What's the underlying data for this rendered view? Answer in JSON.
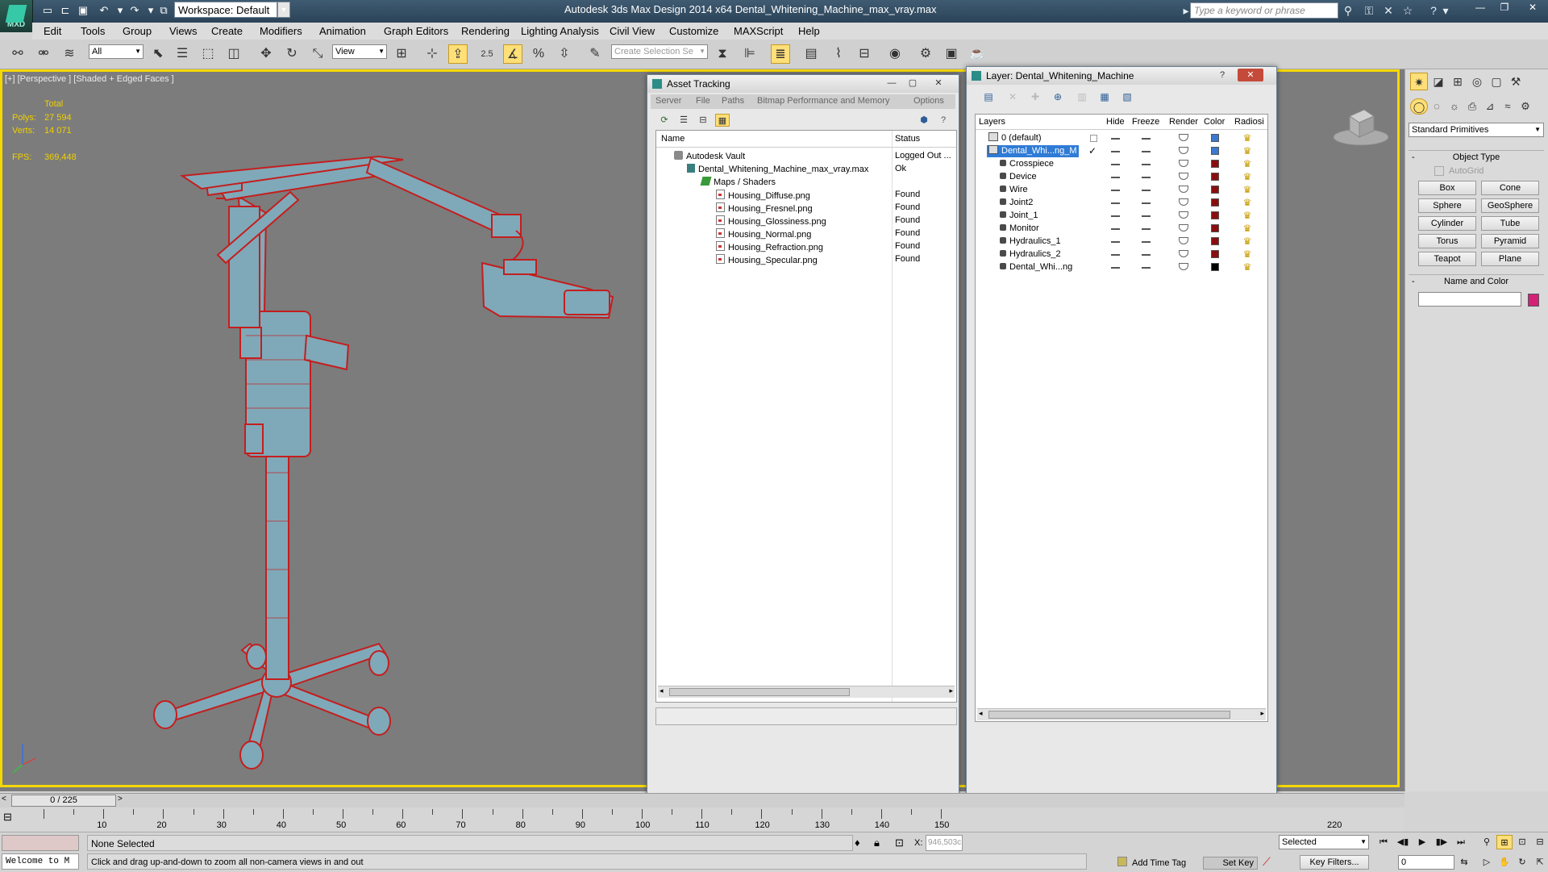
{
  "titlebar": {
    "logo_text": "MXD",
    "workspace": "Workspace: Default",
    "title": "Autodesk 3ds Max Design 2014 x64     Dental_Whitening_Machine_max_vray.max",
    "search_placeholder": "Type a keyword or phrase"
  },
  "menu": [
    "Edit",
    "Tools",
    "Group",
    "Views",
    "Create",
    "Modifiers",
    "Animation",
    "Graph Editors",
    "Rendering",
    "Lighting Analysis",
    "Civil View",
    "Customize",
    "MAXScript",
    "Help"
  ],
  "toolbar": {
    "filter_value": "All",
    "refcoord_value": "View",
    "snap_label": "2.5",
    "selection_set_placeholder": "Create Selection Se"
  },
  "viewport": {
    "label": "[+] [Perspective ] [Shaded + Edged Faces ]",
    "stats_total": "Total",
    "polys_label": "Polys:",
    "polys_value": "27 594",
    "verts_label": "Verts:",
    "verts_value": "14 071",
    "fps_label": "FPS:",
    "fps_value": "369,448"
  },
  "asset_tracking": {
    "title": "Asset Tracking",
    "menus": [
      "Server",
      "File",
      "Paths",
      "Bitmap Performance and Memory",
      "Options"
    ],
    "col_name": "Name",
    "col_status": "Status",
    "rows": [
      {
        "name": "Autodesk Vault",
        "status": "Logged Out ..."
      },
      {
        "name": "Dental_Whitening_Machine_max_vray.max",
        "status": "Ok"
      },
      {
        "name": "Maps / Shaders",
        "status": ""
      },
      {
        "name": "Housing_Diffuse.png",
        "status": "Found"
      },
      {
        "name": "Housing_Fresnel.png",
        "status": "Found"
      },
      {
        "name": "Housing_Glossiness.png",
        "status": "Found"
      },
      {
        "name": "Housing_Normal.png",
        "status": "Found"
      },
      {
        "name": "Housing_Refraction.png",
        "status": "Found"
      },
      {
        "name": "Housing_Specular.png",
        "status": "Found"
      }
    ]
  },
  "layer_dialog": {
    "title": "Layer: Dental_Whitening_Machine",
    "help": "?",
    "col_layers": "Layers",
    "col_hide": "Hide",
    "col_freeze": "Freeze",
    "col_render": "Render",
    "col_color": "Color",
    "col_radiosity": "Radiosi",
    "rows": [
      {
        "name": "0 (default)",
        "color": "#3c78d0",
        "kind": "layer"
      },
      {
        "name": "Dental_Whi...ng_M",
        "color": "#3c78d0",
        "kind": "layer",
        "current_mark": "✓"
      },
      {
        "name": "Crosspiece",
        "color": "#8b0e0e",
        "kind": "object"
      },
      {
        "name": "Device",
        "color": "#8b0e0e",
        "kind": "object"
      },
      {
        "name": "Wire",
        "color": "#8b0e0e",
        "kind": "object"
      },
      {
        "name": "Joint2",
        "color": "#8b0e0e",
        "kind": "object"
      },
      {
        "name": "Joint_1",
        "color": "#8b0e0e",
        "kind": "object"
      },
      {
        "name": "Monitor",
        "color": "#8b0e0e",
        "kind": "object"
      },
      {
        "name": "Hydraulics_1",
        "color": "#8b0e0e",
        "kind": "object"
      },
      {
        "name": "Hydraulics_2",
        "color": "#8b0e0e",
        "kind": "object"
      },
      {
        "name": "Dental_Whi...ng",
        "color": "#000000",
        "kind": "object"
      }
    ]
  },
  "command_panel": {
    "category": "Standard Primitives",
    "object_type": "Object Type",
    "autogrid": "AutoGrid",
    "buttons": [
      "Box",
      "Cone",
      "Sphere",
      "GeoSphere",
      "Cylinder",
      "Tube",
      "Torus",
      "Pyramid",
      "Teapot",
      "Plane"
    ],
    "name_and_color": "Name and Color",
    "object_color": "#d42178"
  },
  "timeline": {
    "frame_display": "0 / 225",
    "ticks": [
      "10",
      "20",
      "30",
      "40",
      "50",
      "60",
      "70",
      "80",
      "90",
      "100",
      "110",
      "120",
      "130",
      "140",
      "150",
      "220"
    ]
  },
  "status": {
    "listener": "Welcome to M",
    "selection": "None Selected",
    "prompt": "Click and drag up-and-down to zoom all non-camera views in and out",
    "coord_label": "X:",
    "coord_x": "946,503c",
    "selected_combo": "Selected",
    "add_time_tag": "Add Time Tag",
    "set_key": "Set Key",
    "key_filters": "Key Filters...",
    "frame_value": "0"
  },
  "colors": {
    "viewport_bg": "#7c7c7c",
    "wire": "#c41e1e",
    "mesh_fill": "#7fa9b8",
    "active_yellow": "#f5d800"
  }
}
